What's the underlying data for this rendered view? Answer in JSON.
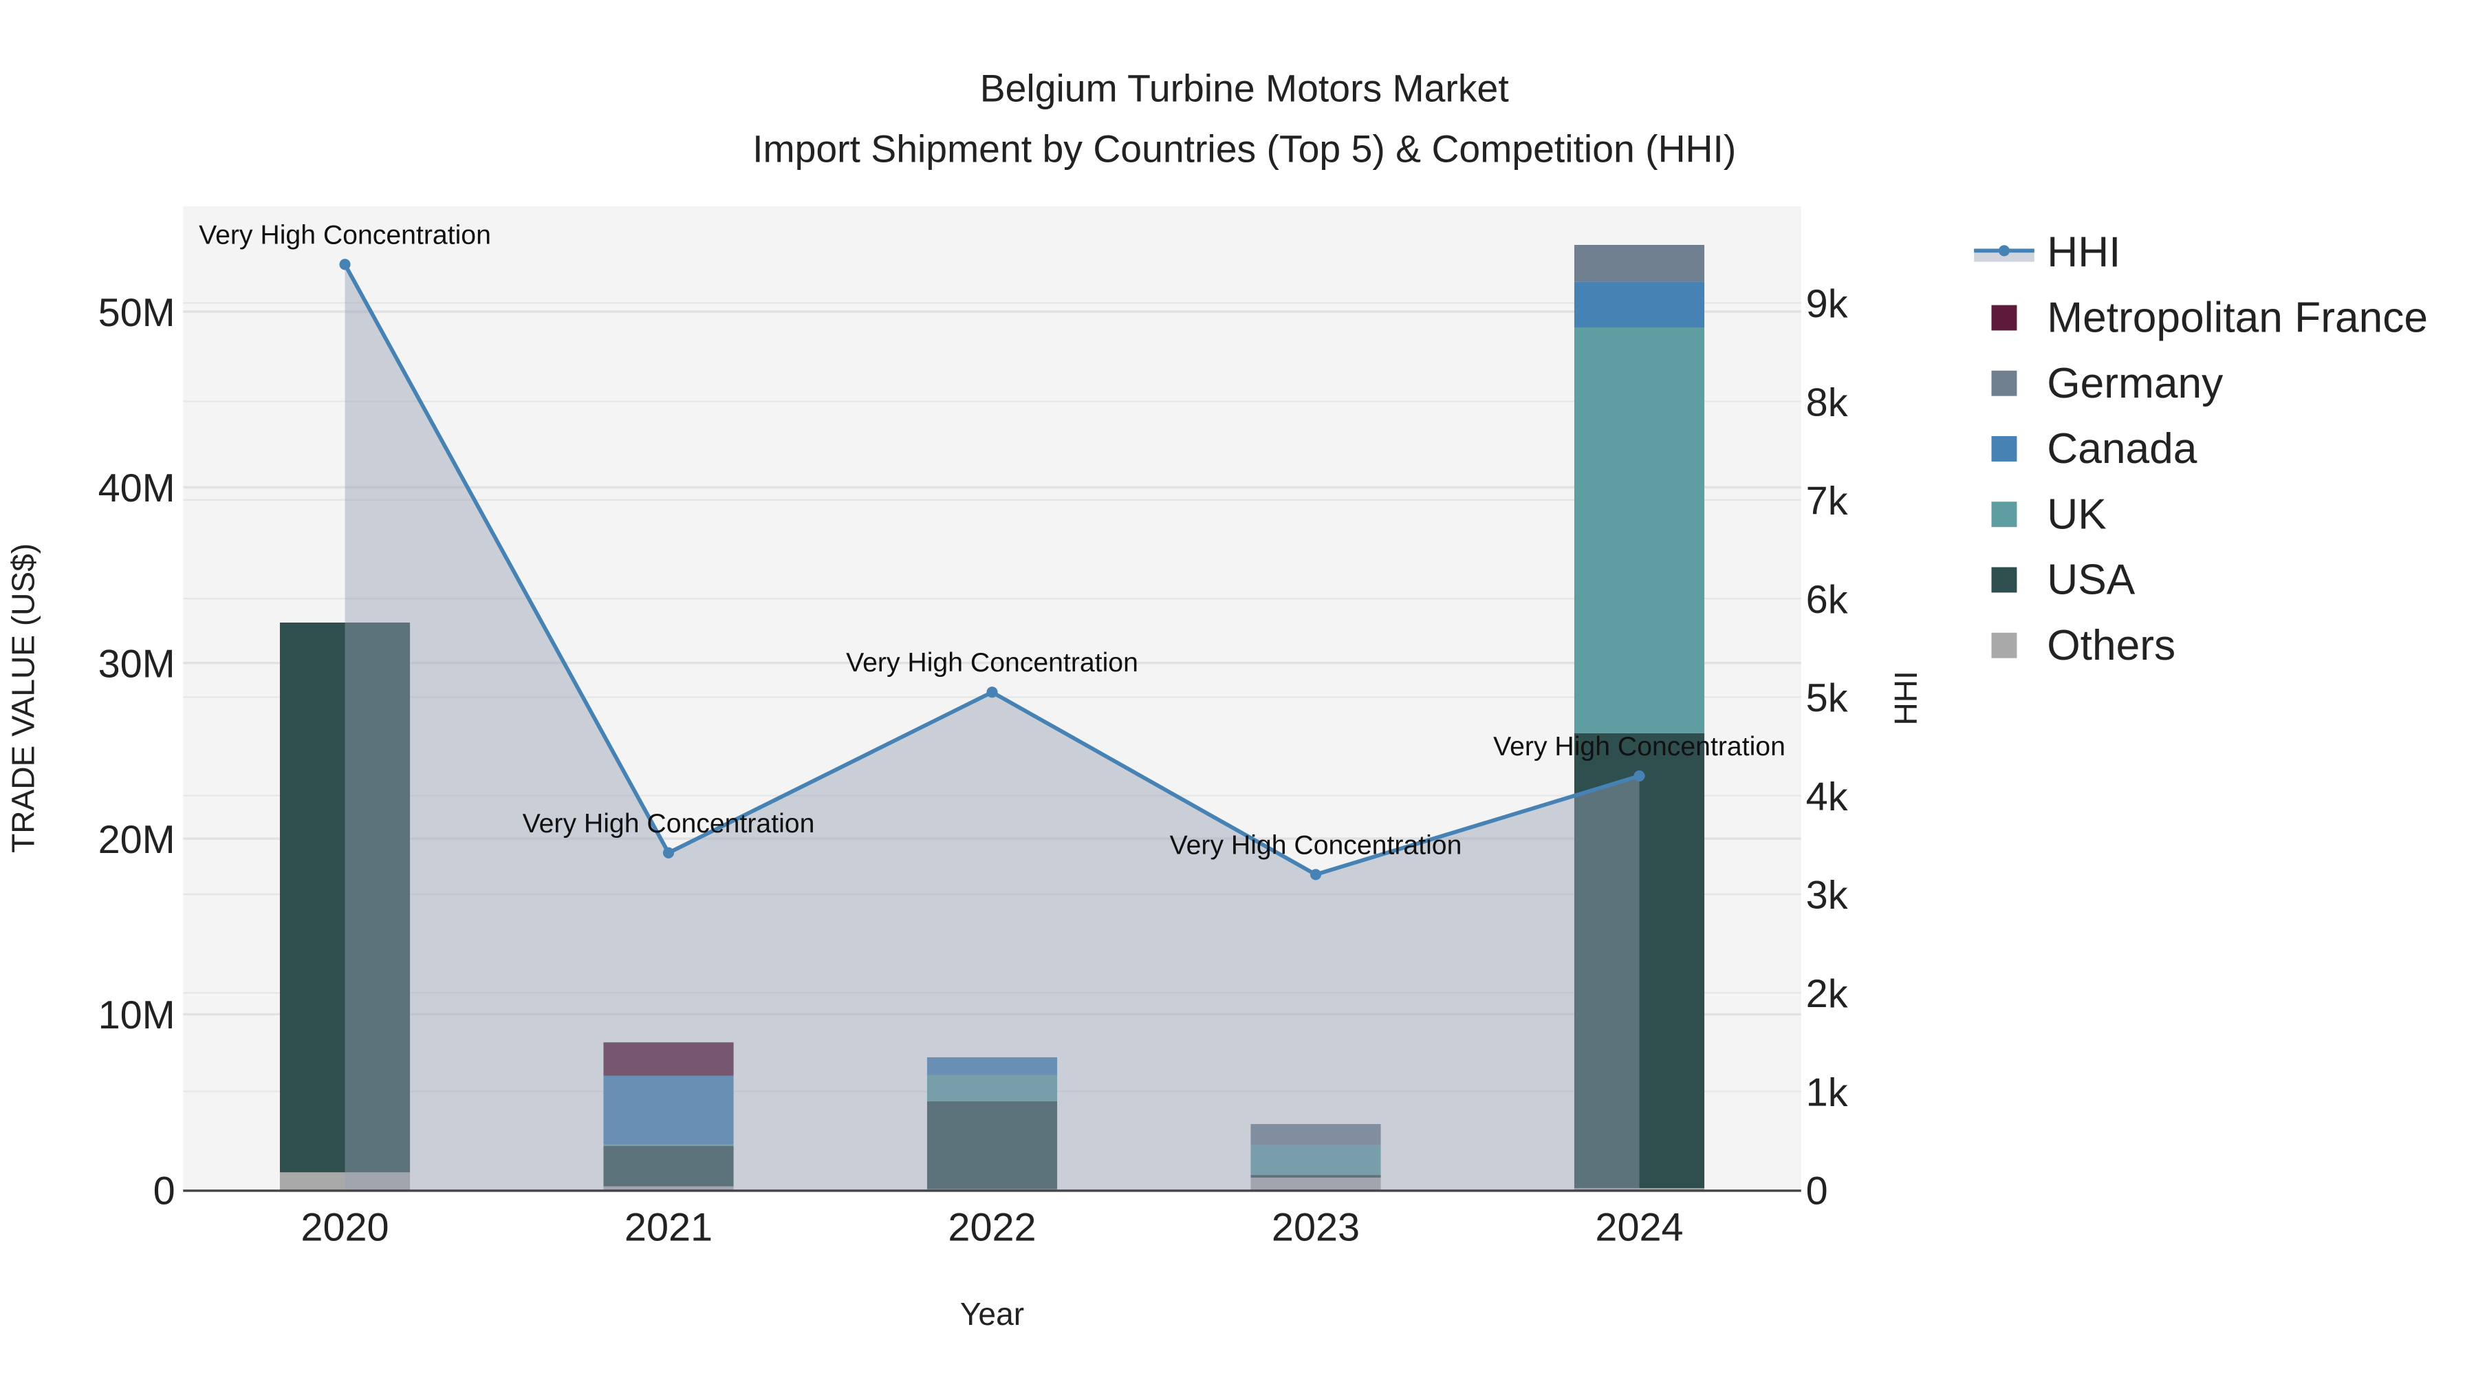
{
  "chart_data": {
    "type": "bar",
    "title": "Belgium Turbine Motors Market",
    "subtitle": "Import Shipment by Countries (Top 5) & Competition (HHI)",
    "xlabel": "Year",
    "ylabel": "TRADE VALUE (US$)",
    "y2label": "HHI",
    "categories": [
      "2020",
      "2021",
      "2022",
      "2023",
      "2024"
    ],
    "ylim": [
      0,
      56000000
    ],
    "y2lim": [
      0,
      9980
    ],
    "yticks": [
      {
        "v": 0,
        "label": "0"
      },
      {
        "v": 10000000,
        "label": "10M"
      },
      {
        "v": 20000000,
        "label": "20M"
      },
      {
        "v": 30000000,
        "label": "30M"
      },
      {
        "v": 40000000,
        "label": "40M"
      },
      {
        "v": 50000000,
        "label": "50M"
      }
    ],
    "y2ticks": [
      {
        "v": 0,
        "label": "0"
      },
      {
        "v": 1000,
        "label": "1k"
      },
      {
        "v": 2000,
        "label": "2k"
      },
      {
        "v": 3000,
        "label": "3k"
      },
      {
        "v": 4000,
        "label": "4k"
      },
      {
        "v": 5000,
        "label": "5k"
      },
      {
        "v": 6000,
        "label": "6k"
      },
      {
        "v": 7000,
        "label": "7k"
      },
      {
        "v": 8000,
        "label": "8k"
      },
      {
        "v": 9000,
        "label": "9k"
      }
    ],
    "series": [
      {
        "name": "Others",
        "color": "#a9a9a9",
        "values": [
          1000000,
          200000,
          50000,
          700000,
          100000
        ]
      },
      {
        "name": "USA",
        "color": "#2f4f4f",
        "values": [
          31300000,
          2300000,
          5000000,
          150000,
          25900000
        ]
      },
      {
        "name": "UK",
        "color": "#5f9ea0",
        "values": [
          0,
          100000,
          1500000,
          1700000,
          23100000
        ]
      },
      {
        "name": "Canada",
        "color": "#4682b4",
        "values": [
          0,
          3900000,
          1000000,
          0,
          2600000
        ]
      },
      {
        "name": "Germany",
        "color": "#708090",
        "values": [
          0,
          0,
          0,
          1200000,
          2100000
        ]
      },
      {
        "name": "Metropolitan France",
        "color": "#5e1a3a",
        "values": [
          0,
          1900000,
          0,
          0,
          0
        ]
      }
    ],
    "hhi": {
      "name": "HHI",
      "color": "#4682b4",
      "values": [
        9390,
        3420,
        5050,
        3200,
        4200
      ],
      "annotations": [
        "Very High Concentration",
        "Very High Concentration",
        "Very High Concentration",
        "Very High Concentration",
        "Very High Concentration"
      ]
    },
    "legend": {
      "placement": "right",
      "order": [
        "HHI",
        "Metropolitan France",
        "Germany",
        "Canada",
        "UK",
        "USA",
        "Others"
      ]
    },
    "grid": true
  }
}
